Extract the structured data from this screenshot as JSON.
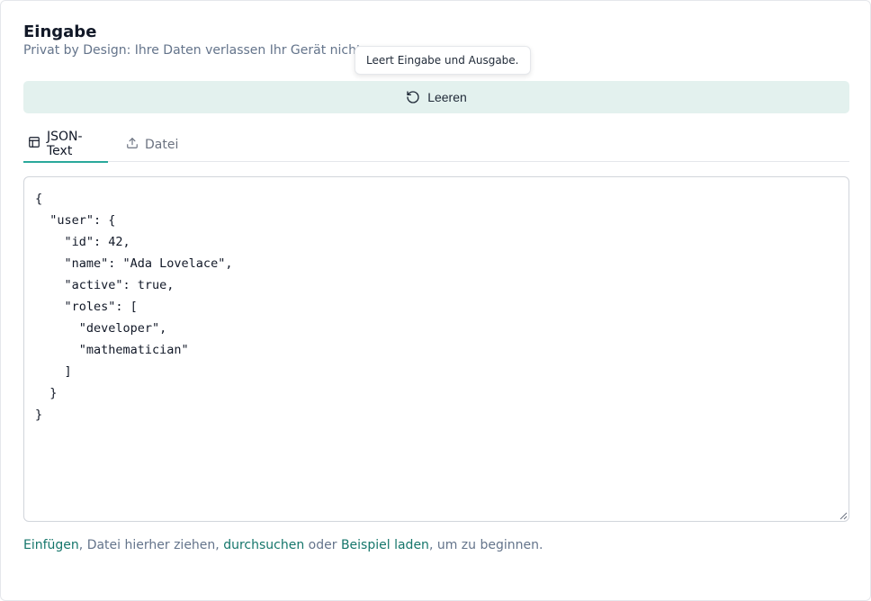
{
  "section": {
    "title": "Eingabe",
    "subtitle": "Privat by Design: Ihre Daten verlassen Ihr Gerät nicht."
  },
  "tooltip": {
    "text": "Leert Eingabe und Ausgabe."
  },
  "clear_button": {
    "label": "Leeren",
    "icon": "rotate-ccw-icon"
  },
  "tabs": [
    {
      "label": "JSON-Text",
      "icon": "table-icon",
      "active": true
    },
    {
      "label": "Datei",
      "icon": "upload-icon",
      "active": false
    }
  ],
  "editor": {
    "value": "{\n  \"user\": {\n    \"id\": 42,\n    \"name\": \"Ada Lovelace\",\n    \"active\": true,\n    \"roles\": [\n      \"developer\",\n      \"mathematician\"\n    ]\n  }\n}"
  },
  "hint": {
    "paste_link": "Einfügen",
    "text_1": ", Datei hierher ziehen, ",
    "browse_link": "durchsuchen",
    "text_2": " oder ",
    "example_link": "Beispiel laden",
    "text_3": ", um zu beginnen."
  },
  "colors": {
    "accent": "#2aa89b",
    "link": "#15766b",
    "button_bg": "#e3f1ee",
    "muted_text": "#64748b"
  }
}
